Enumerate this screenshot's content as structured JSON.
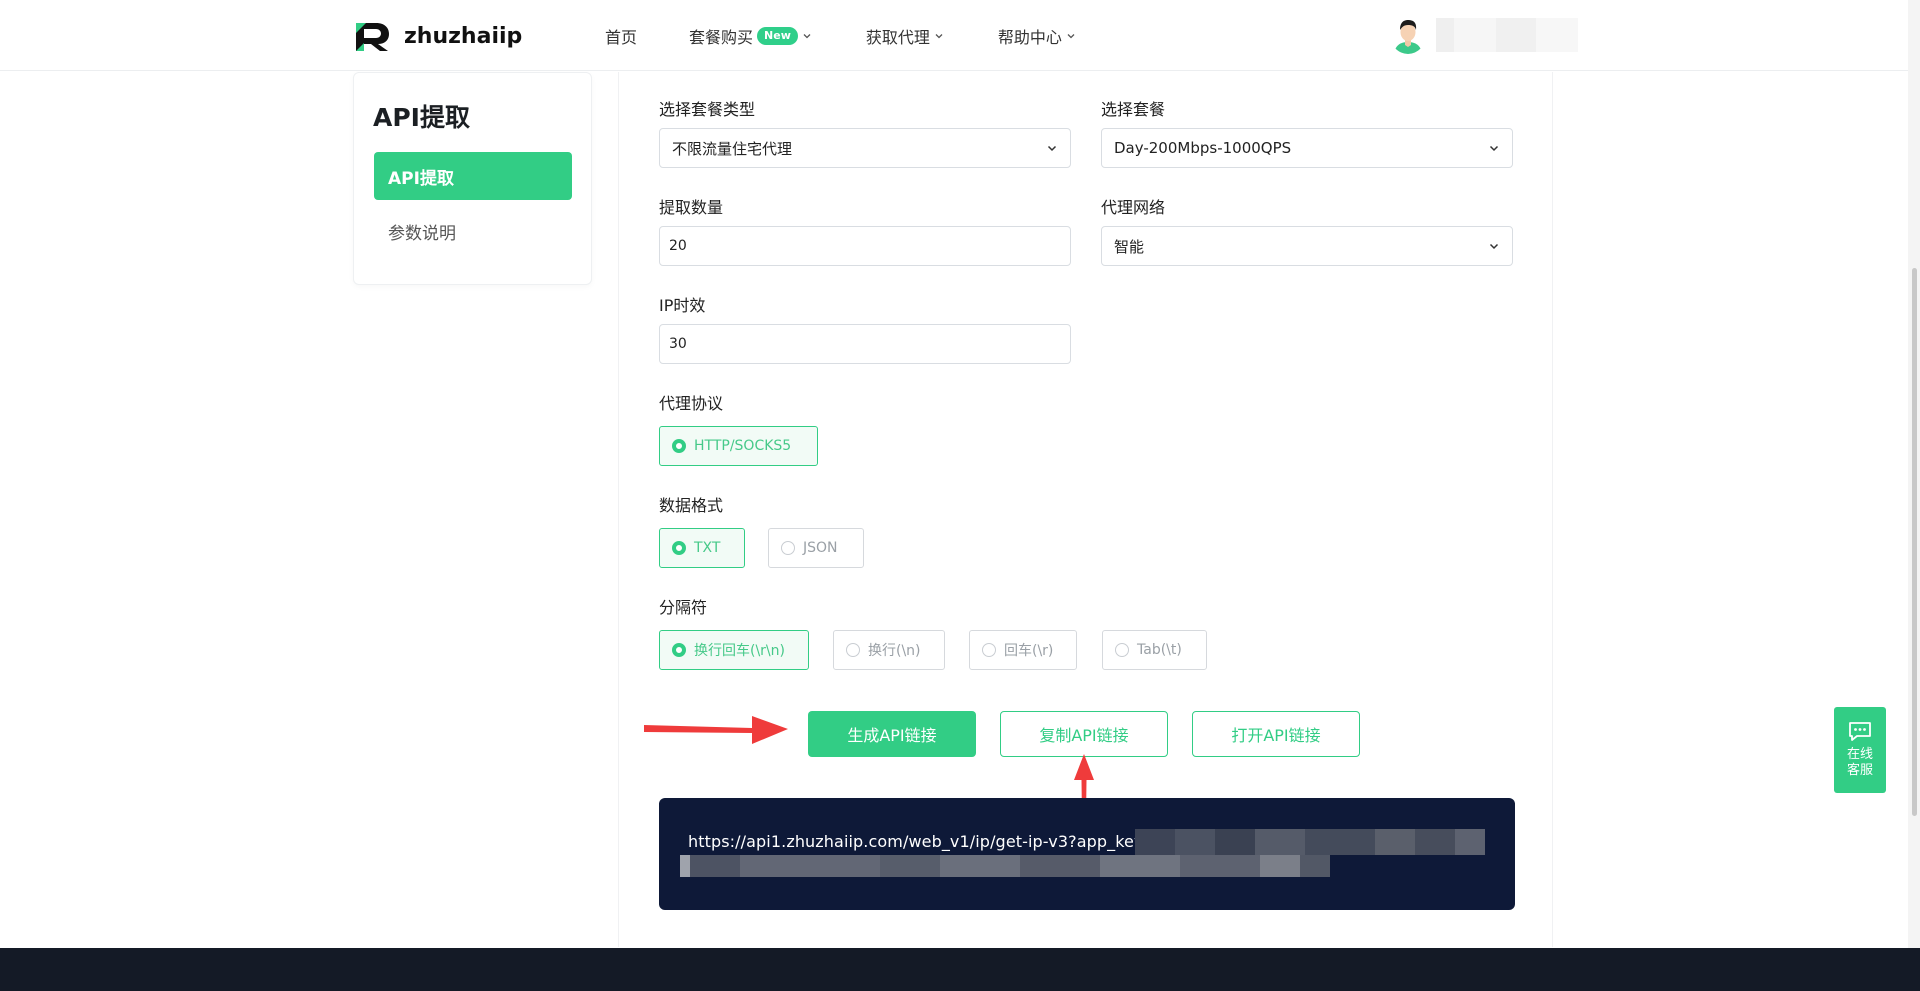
{
  "header": {
    "brand": "zhuzhaiip",
    "nav": [
      {
        "label": "首页"
      },
      {
        "label": "套餐购买",
        "badge": "New"
      },
      {
        "label": "获取代理"
      },
      {
        "label": "帮助中心"
      }
    ]
  },
  "sidebar": {
    "title": "API提取",
    "items": [
      {
        "label": "API提取",
        "active": true
      },
      {
        "label": "参数说明",
        "active": false
      }
    ]
  },
  "form": {
    "package_type": {
      "label": "选择套餐类型",
      "value": "不限流量住宅代理"
    },
    "package": {
      "label": "选择套餐",
      "value": "Day-200Mbps-1000QPS"
    },
    "quantity": {
      "label": "提取数量",
      "value": "20"
    },
    "network": {
      "label": "代理网络",
      "value": "智能"
    },
    "ttl": {
      "label": "IP时效",
      "value": "30"
    },
    "protocol": {
      "label": "代理协议",
      "options": [
        {
          "label": "HTTP/SOCKS5",
          "selected": true
        }
      ]
    },
    "format": {
      "label": "数据格式",
      "options": [
        {
          "label": "TXT",
          "selected": true
        },
        {
          "label": "JSON",
          "selected": false
        }
      ]
    },
    "separator": {
      "label": "分隔符",
      "options": [
        {
          "label": "换行回车(\\r\\n)",
          "selected": true
        },
        {
          "label": "换行(\\n)",
          "selected": false
        },
        {
          "label": "回车(\\r)",
          "selected": false
        },
        {
          "label": "Tab(\\t)",
          "selected": false
        }
      ]
    }
  },
  "actions": {
    "generate": "生成API链接",
    "copy": "复制API链接",
    "open": "打开API链接"
  },
  "result": {
    "url": "https://api1.zhuzhaiip.com/web_v1/ip/get-ip-v3?app_key="
  },
  "float_chat": {
    "line1": "在线",
    "line2": "客服"
  },
  "colors": {
    "accent": "#32cd85",
    "result_bg": "#0e1938",
    "footer_bg": "#141a26",
    "arrow": "#ef3b3b"
  }
}
